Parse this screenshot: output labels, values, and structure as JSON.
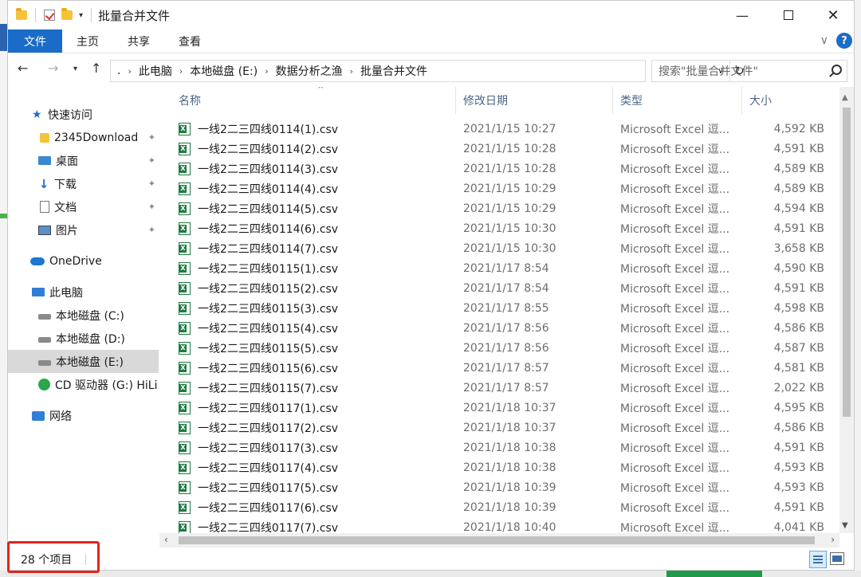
{
  "window": {
    "title": "批量合并文件",
    "controls": {
      "minimize": "—",
      "close": "✕"
    }
  },
  "ribbon": {
    "tabs": [
      "文件",
      "主页",
      "共享",
      "查看"
    ]
  },
  "address": {
    "crumbs": [
      ".",
      "此电脑",
      "本地磁盘 (E:)",
      "数据分析之渔",
      "批量合并文件"
    ]
  },
  "search": {
    "placeholder": "搜索\"批量合并文件\""
  },
  "nav": {
    "items": [
      {
        "label": "快速访问",
        "icon": "star-icon"
      },
      {
        "label": "2345Download",
        "icon": "folder-icon",
        "pinned": true
      },
      {
        "label": "桌面",
        "icon": "desktop-icon",
        "pinned": true
      },
      {
        "label": "下载",
        "icon": "download-icon",
        "pinned": true
      },
      {
        "label": "文档",
        "icon": "document-icon",
        "pinned": true
      },
      {
        "label": "图片",
        "icon": "picture-icon",
        "pinned": true
      },
      {
        "label": "OneDrive",
        "icon": "cloud-icon"
      },
      {
        "label": "此电脑",
        "icon": "computer-icon"
      },
      {
        "label": "本地磁盘 (C:)",
        "icon": "drive-icon"
      },
      {
        "label": "本地磁盘 (D:)",
        "icon": "drive-icon"
      },
      {
        "label": "本地磁盘 (E:)",
        "icon": "drive-icon",
        "selected": true
      },
      {
        "label": "CD 驱动器 (G:) HiLi",
        "icon": "cd-drive-icon"
      },
      {
        "label": "网络",
        "icon": "network-icon"
      }
    ]
  },
  "columns": {
    "name": "名称",
    "date": "修改日期",
    "type": "类型",
    "size": "大小"
  },
  "files": [
    {
      "name": "一线2二三四线0114(1).csv",
      "date": "2021/1/15 10:27",
      "type": "Microsoft Excel 逗...",
      "size": "4,592 KB"
    },
    {
      "name": "一线2二三四线0114(2).csv",
      "date": "2021/1/15 10:28",
      "type": "Microsoft Excel 逗...",
      "size": "4,591 KB"
    },
    {
      "name": "一线2二三四线0114(3).csv",
      "date": "2021/1/15 10:28",
      "type": "Microsoft Excel 逗...",
      "size": "4,589 KB"
    },
    {
      "name": "一线2二三四线0114(4).csv",
      "date": "2021/1/15 10:29",
      "type": "Microsoft Excel 逗...",
      "size": "4,589 KB"
    },
    {
      "name": "一线2二三四线0114(5).csv",
      "date": "2021/1/15 10:29",
      "type": "Microsoft Excel 逗...",
      "size": "4,594 KB"
    },
    {
      "name": "一线2二三四线0114(6).csv",
      "date": "2021/1/15 10:30",
      "type": "Microsoft Excel 逗...",
      "size": "4,591 KB"
    },
    {
      "name": "一线2二三四线0114(7).csv",
      "date": "2021/1/15 10:30",
      "type": "Microsoft Excel 逗...",
      "size": "3,658 KB"
    },
    {
      "name": "一线2二三四线0115(1).csv",
      "date": "2021/1/17 8:54",
      "type": "Microsoft Excel 逗...",
      "size": "4,590 KB"
    },
    {
      "name": "一线2二三四线0115(2).csv",
      "date": "2021/1/17 8:54",
      "type": "Microsoft Excel 逗...",
      "size": "4,591 KB"
    },
    {
      "name": "一线2二三四线0115(3).csv",
      "date": "2021/1/17 8:55",
      "type": "Microsoft Excel 逗...",
      "size": "4,598 KB"
    },
    {
      "name": "一线2二三四线0115(4).csv",
      "date": "2021/1/17 8:56",
      "type": "Microsoft Excel 逗...",
      "size": "4,586 KB"
    },
    {
      "name": "一线2二三四线0115(5).csv",
      "date": "2021/1/17 8:56",
      "type": "Microsoft Excel 逗...",
      "size": "4,587 KB"
    },
    {
      "name": "一线2二三四线0115(6).csv",
      "date": "2021/1/17 8:57",
      "type": "Microsoft Excel 逗...",
      "size": "4,581 KB"
    },
    {
      "name": "一线2二三四线0115(7).csv",
      "date": "2021/1/17 8:57",
      "type": "Microsoft Excel 逗...",
      "size": "2,022 KB"
    },
    {
      "name": "一线2二三四线0117(1).csv",
      "date": "2021/1/18 10:37",
      "type": "Microsoft Excel 逗...",
      "size": "4,595 KB"
    },
    {
      "name": "一线2二三四线0117(2).csv",
      "date": "2021/1/18 10:37",
      "type": "Microsoft Excel 逗...",
      "size": "4,586 KB"
    },
    {
      "name": "一线2二三四线0117(3).csv",
      "date": "2021/1/18 10:38",
      "type": "Microsoft Excel 逗...",
      "size": "4,591 KB"
    },
    {
      "name": "一线2二三四线0117(4).csv",
      "date": "2021/1/18 10:38",
      "type": "Microsoft Excel 逗...",
      "size": "4,593 KB"
    },
    {
      "name": "一线2二三四线0117(5).csv",
      "date": "2021/1/18 10:39",
      "type": "Microsoft Excel 逗...",
      "size": "4,593 KB"
    },
    {
      "name": "一线2二三四线0117(6).csv",
      "date": "2021/1/18 10:39",
      "type": "Microsoft Excel 逗...",
      "size": "4,591 KB"
    },
    {
      "name": "一线2二三四线0117(7).csv",
      "date": "2021/1/18 10:40",
      "type": "Microsoft Excel 逗...",
      "size": "4,041 KB"
    }
  ],
  "status": {
    "count": "28 个项目"
  },
  "colors": {
    "accent": "#1a6cc8",
    "highlight": "#e0261c",
    "header_text": "#4a6785",
    "excel_green": "#1f7a42"
  }
}
